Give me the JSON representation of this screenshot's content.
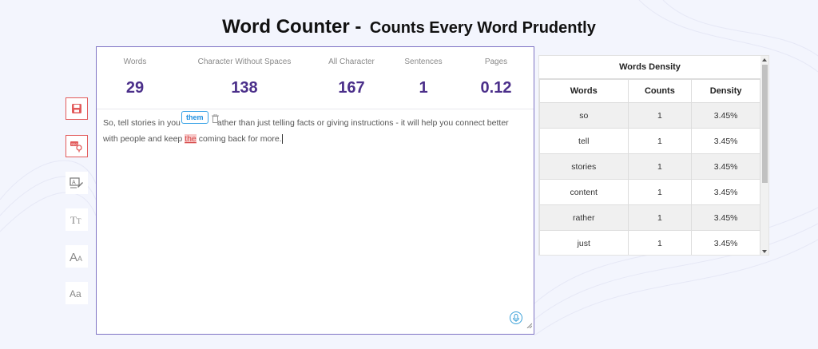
{
  "header": {
    "title": "Word Counter -",
    "subtitle": "Counts Every Word Prudently"
  },
  "toolbar": {
    "tools": [
      {
        "icon": "save-icon"
      },
      {
        "icon": "keyword-search-icon"
      },
      {
        "icon": "image-text-icon"
      },
      {
        "icon": "text-format-icon"
      },
      {
        "icon": "font-size-icon"
      },
      {
        "icon": "case-change-icon"
      }
    ]
  },
  "stats": [
    {
      "label": "Words",
      "value": "29"
    },
    {
      "label": "Character Without Spaces",
      "value": "138"
    },
    {
      "label": "All Character",
      "value": "167"
    },
    {
      "label": "Sentences",
      "value": "1"
    },
    {
      "label": "Pages",
      "value": "0.12"
    }
  ],
  "editor": {
    "line1_a": "So, tell stories in you",
    "line1_b": "ather than just telling facts or giving instructions - it will help you connect better",
    "line2_a": "with people and keep ",
    "highlight": "the",
    "line2_b": " coming back for more.",
    "suggestion": "them"
  },
  "density": {
    "title": "Words Density",
    "headers": [
      "Words",
      "Counts",
      "Density"
    ],
    "rows": [
      {
        "word": "so",
        "count": "1",
        "density": "3.45%"
      },
      {
        "word": "tell",
        "count": "1",
        "density": "3.45%"
      },
      {
        "word": "stories",
        "count": "1",
        "density": "3.45%"
      },
      {
        "word": "content",
        "count": "1",
        "density": "3.45%"
      },
      {
        "word": "rather",
        "count": "1",
        "density": "3.45%"
      },
      {
        "word": "just",
        "count": "1",
        "density": "3.45%"
      }
    ]
  },
  "colors": {
    "accent": "#4b2f8a",
    "tool_red": "#e25b5b",
    "highlight": "#f7c8c8"
  }
}
